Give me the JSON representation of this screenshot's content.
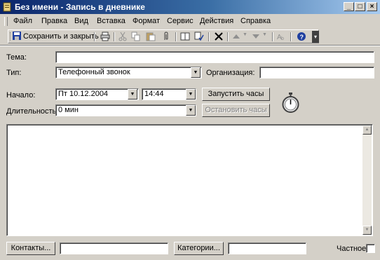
{
  "window": {
    "title": "Без имени - Запись в дневнике"
  },
  "menubar": {
    "items": [
      {
        "label": "Файл"
      },
      {
        "label": "Правка"
      },
      {
        "label": "Вид"
      },
      {
        "label": "Вставка"
      },
      {
        "label": "Формат"
      },
      {
        "label": "Сервис"
      },
      {
        "label": "Действия"
      },
      {
        "label": "Справка"
      }
    ]
  },
  "toolbar": {
    "save_close_label": "Сохранить и закрыть",
    "icons": [
      "print-icon",
      "cut-icon",
      "copy-icon",
      "paste-icon",
      "attach-icon",
      "address-book-icon",
      "check-names-icon",
      "delete-icon",
      "up-arrow-icon",
      "down-arrow-icon",
      "format-icon",
      "help-icon"
    ]
  },
  "form": {
    "subject_label": "Тема:",
    "subject_value": "",
    "type_label": "Тип:",
    "type_value": "Телефонный звонок",
    "organization_label": "Организация:",
    "organization_value": "",
    "start_label": "Начало:",
    "start_date": "Пт 10.12.2004",
    "start_time": "14:44",
    "start_timer_button": "Запустить часы",
    "duration_label": "Длительность:",
    "duration_value": "0 мин",
    "stop_timer_button": "Остановить часы",
    "notes": ""
  },
  "footer": {
    "contacts_button": "Контакты...",
    "contacts_value": "",
    "categories_button": "Категории...",
    "categories_value": "",
    "private_label": "Частное",
    "private_checked": false
  }
}
